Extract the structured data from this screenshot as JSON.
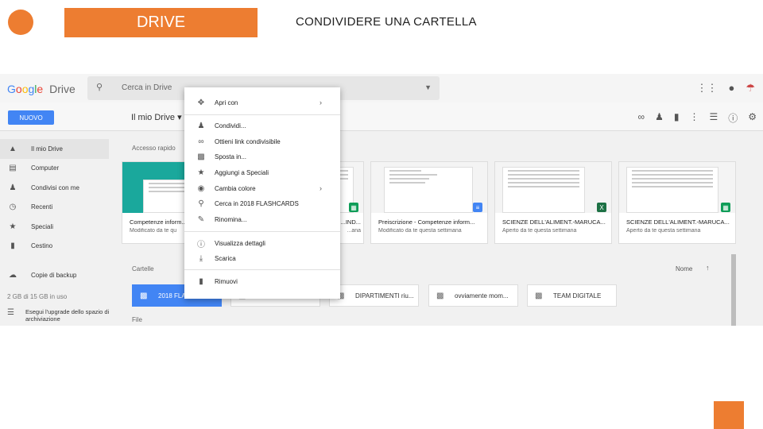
{
  "slide": {
    "title": "DRIVE",
    "heading": "CONDIVIDERE UNA CARTELLA",
    "accent_color": "#ed7d31"
  },
  "drive": {
    "logo_google": [
      "G",
      "o",
      "o",
      "g",
      "l",
      "e"
    ],
    "logo_drive": "Drive",
    "search_placeholder": "Cerca in Drive",
    "new_button": "NUOVO",
    "breadcrumb": "Il mio Drive",
    "top_icons": [
      "apps-grid-icon",
      "notifications-icon",
      "account-avatar-icon"
    ],
    "toolbar_icons": [
      "link-icon",
      "add-person-icon",
      "trash-icon",
      "more-vert-icon",
      "list-view-icon",
      "info-icon",
      "settings-icon"
    ],
    "sidebar": [
      {
        "label": "Il mio Drive",
        "icon": "drive-icon",
        "active": true
      },
      {
        "label": "Computer",
        "icon": "computer-icon"
      },
      {
        "label": "Condivisi con me",
        "icon": "people-icon"
      },
      {
        "label": "Recenti",
        "icon": "clock-icon"
      },
      {
        "label": "Speciali",
        "icon": "star-icon"
      },
      {
        "label": "Cestino",
        "icon": "trash-icon"
      }
    ],
    "backup_label": "Copie di backup",
    "storage_text": "2 GB di 15 GB in uso",
    "upgrade_text": "Esegui l'upgrade dello spazio di archiviazione",
    "quick_access_label": "Accesso rapido",
    "cards": [
      {
        "title": "Competenze inform...",
        "subtitle": "Modificato da te qu",
        "badge": "",
        "badge_color": ""
      },
      {
        "title": "...IND...",
        "subtitle": "...ana",
        "badge": "▦",
        "badge_color": "#0f9d58"
      },
      {
        "title": "Preiscrizione - Competenze inform...",
        "subtitle": "Modificato da te questa settimana",
        "badge": "≡",
        "badge_color": "#4285f4"
      },
      {
        "title": "SCIENZE DELL'ALIMENT.-MARUCA...",
        "subtitle": "Aperto da te questa settimana",
        "badge": "X",
        "badge_color": "#1d7145"
      },
      {
        "title": "SCIENZE DELL'ALIMENT.-MARUCA...",
        "subtitle": "Aperto da te questa settimana",
        "badge": "▦",
        "badge_color": "#0f9d58"
      }
    ],
    "folders_label": "Cartelle",
    "files_label": "File",
    "sort_label": "Nome",
    "folders": [
      {
        "name": "2018 FLA",
        "selected": true
      },
      {
        "name": "",
        "selected": false
      },
      {
        "name": "DIPARTIMENTI riu...",
        "selected": false
      },
      {
        "name": "ovviamente mom...",
        "selected": false
      },
      {
        "name": "TEAM DIGITALE",
        "selected": false
      }
    ],
    "context_menu": [
      {
        "label": "Apri con",
        "icon": "open-with-icon",
        "submenu": true
      },
      {
        "label": "Condividi...",
        "icon": "add-person-icon"
      },
      {
        "label": "Ottieni link condivisibile",
        "icon": "link-icon"
      },
      {
        "label": "Sposta in...",
        "icon": "move-folder-icon"
      },
      {
        "label": "Aggiungi a Speciali",
        "icon": "star-icon"
      },
      {
        "label": "Cambia colore",
        "icon": "palette-icon",
        "submenu": true
      },
      {
        "label": "Cerca in 2018 FLASHCARDS",
        "icon": "search-icon"
      },
      {
        "label": "Rinomina...",
        "icon": "edit-icon"
      },
      {
        "label": "Visualizza dettagli",
        "icon": "info-icon"
      },
      {
        "label": "Scarica",
        "icon": "download-icon"
      },
      {
        "label": "Rimuovi",
        "icon": "trash-icon"
      }
    ]
  }
}
